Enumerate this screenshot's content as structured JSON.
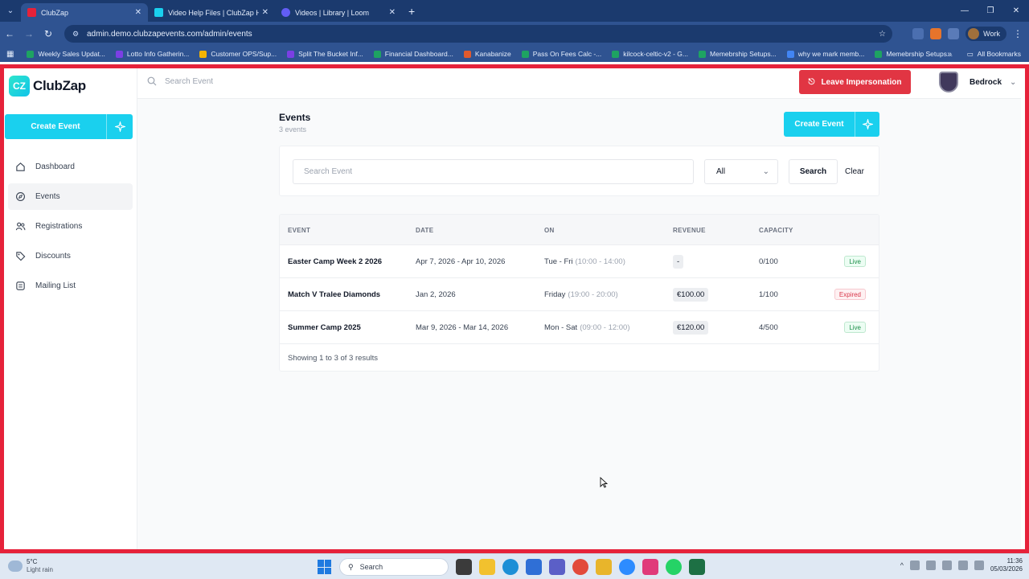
{
  "browser": {
    "tabs": [
      {
        "label": "ClubZap",
        "color": "#e6223a",
        "active": true
      },
      {
        "label": "Video Help Files | ClubZap Help",
        "color": "#1ad0ee",
        "active": false
      },
      {
        "label": "Videos | Library | Loom",
        "color": "#625df5",
        "active": false
      }
    ],
    "url": "admin.demo.clubzapevents.com/admin/events",
    "profile": "Work",
    "bookmarks": [
      {
        "label": "Weekly Sales Updat...",
        "color": "#1ea362"
      },
      {
        "label": "Lotto Info Gatherin...",
        "color": "#7b3fe4"
      },
      {
        "label": "Customer OPS/Sup...",
        "color": "#f4b400"
      },
      {
        "label": "Split The Bucket Inf...",
        "color": "#7b3fe4"
      },
      {
        "label": "Financial Dashboard...",
        "color": "#1ea362"
      },
      {
        "label": "Kanabanize",
        "color": "#e15a2d"
      },
      {
        "label": "Pass On Fees Calc -...",
        "color": "#1ea362"
      },
      {
        "label": "kilcock-celtic-v2 - G...",
        "color": "#1ea362"
      },
      {
        "label": "Memebrship Setups...",
        "color": "#1ea362"
      },
      {
        "label": "why we mark memb...",
        "color": "#4285f4"
      },
      {
        "label": "Memebrship Setups...",
        "color": "#1ea362"
      }
    ],
    "all_bookmarks": "All Bookmarks"
  },
  "sidebar": {
    "brand": "ClubZap",
    "create_label": "Create Event",
    "items": [
      {
        "label": "Dashboard",
        "icon": "home-icon",
        "active": false
      },
      {
        "label": "Events",
        "icon": "compass-icon",
        "active": true
      },
      {
        "label": "Registrations",
        "icon": "users-icon",
        "active": false
      },
      {
        "label": "Discounts",
        "icon": "tag-icon",
        "active": false
      },
      {
        "label": "Mailing List",
        "icon": "list-icon",
        "active": false
      }
    ]
  },
  "topbar": {
    "search_placeholder": "Search Event",
    "leave_label": "Leave Impersonation",
    "account_name": "Bedrock"
  },
  "main": {
    "title": "Events",
    "subtitle": "3 events",
    "create_label": "Create Event",
    "filter": {
      "search_placeholder": "Search Event",
      "select_value": "All",
      "search_button": "Search",
      "clear_button": "Clear"
    },
    "table": {
      "columns": [
        "EVENT",
        "DATE",
        "ON",
        "REVENUE",
        "CAPACITY"
      ],
      "rows": [
        {
          "event": "Easter Camp Week 2 2026",
          "date": "Apr 7, 2026 - Apr 10, 2026",
          "on_days": "Tue - Fri",
          "on_time": "(10:00 - 14:00)",
          "revenue": "-",
          "capacity": "0/100",
          "status": "Live"
        },
        {
          "event": "Match V Tralee Diamonds",
          "date": "Jan 2, 2026",
          "on_days": "Friday",
          "on_time": "(19:00 - 20:00)",
          "revenue": "€100.00",
          "capacity": "1/100",
          "status": "Expired"
        },
        {
          "event": "Summer Camp 2025",
          "date": "Mar 9, 2026 - Mar 14, 2026",
          "on_days": "Mon - Sat",
          "on_time": "(09:00 - 12:00)",
          "revenue": "€120.00",
          "capacity": "4/500",
          "status": "Live"
        }
      ],
      "footer": "Showing 1 to 3 of 3 results"
    }
  },
  "taskbar": {
    "temperature": "5°C",
    "weather": "Light rain",
    "search": "Search",
    "time": "11:36",
    "date": "05/03/2026"
  },
  "colors": {
    "accent": "#1ad0ee",
    "danger": "#e13543",
    "frame": "#e6223a"
  }
}
